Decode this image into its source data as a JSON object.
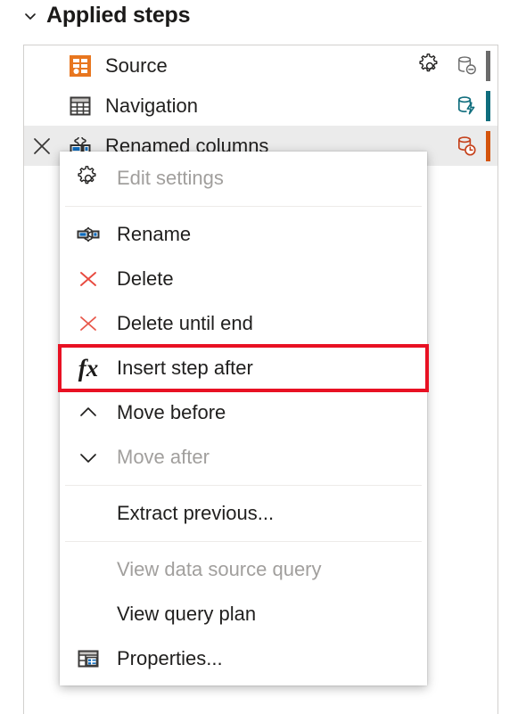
{
  "header": {
    "title": "Applied steps",
    "expand_icon": "chevron-down-icon"
  },
  "steps_panel": {
    "steps": [
      {
        "label": "Source",
        "icon": "source-icon",
        "selected": false,
        "has_gear": true,
        "has_delete": false,
        "db_icon": "database-minus-icon",
        "db_icon_color": "#6b6b6b",
        "state_bar_color": "#6b6b6b"
      },
      {
        "label": "Navigation",
        "icon": "table-icon",
        "selected": false,
        "has_gear": false,
        "has_delete": false,
        "db_icon": "database-lightning-icon",
        "db_icon_color": "#0f6d7d",
        "state_bar_color": "#0f6d7d"
      },
      {
        "label": "Renamed columns",
        "icon": "rename-columns-icon",
        "selected": true,
        "has_gear": false,
        "has_delete": true,
        "delete_icon": "close-icon",
        "db_icon": "database-clock-icon",
        "db_icon_color": "#c5401a",
        "state_bar_color": "#d4540c"
      }
    ]
  },
  "context_menu": {
    "highlight_color": "#e81123",
    "highlighted_item": "Insert step after",
    "items": [
      {
        "label": "Edit settings",
        "icon": "gear-icon",
        "disabled": true,
        "type": "item"
      },
      {
        "type": "separator"
      },
      {
        "label": "Rename",
        "icon": "rename-icon",
        "disabled": false,
        "type": "item"
      },
      {
        "label": "Delete",
        "icon": "delete-x-icon",
        "disabled": false,
        "type": "item"
      },
      {
        "label": "Delete until end",
        "icon": "delete-x-icon",
        "disabled": false,
        "type": "item"
      },
      {
        "label": "Insert step after",
        "icon": "fx-icon",
        "disabled": false,
        "type": "item",
        "highlighted": true
      },
      {
        "label": "Move before",
        "icon": "chevron-up-icon",
        "disabled": false,
        "type": "item"
      },
      {
        "label": "Move after",
        "icon": "chevron-down-icon",
        "disabled": true,
        "type": "item"
      },
      {
        "type": "separator"
      },
      {
        "label": "Extract previous...",
        "icon": "",
        "disabled": false,
        "type": "item"
      },
      {
        "type": "separator"
      },
      {
        "label": "View data source query",
        "icon": "",
        "disabled": true,
        "type": "item"
      },
      {
        "label": "View query plan",
        "icon": "",
        "disabled": false,
        "type": "item"
      },
      {
        "label": "Properties...",
        "icon": "properties-icon",
        "disabled": false,
        "type": "item"
      }
    ]
  }
}
